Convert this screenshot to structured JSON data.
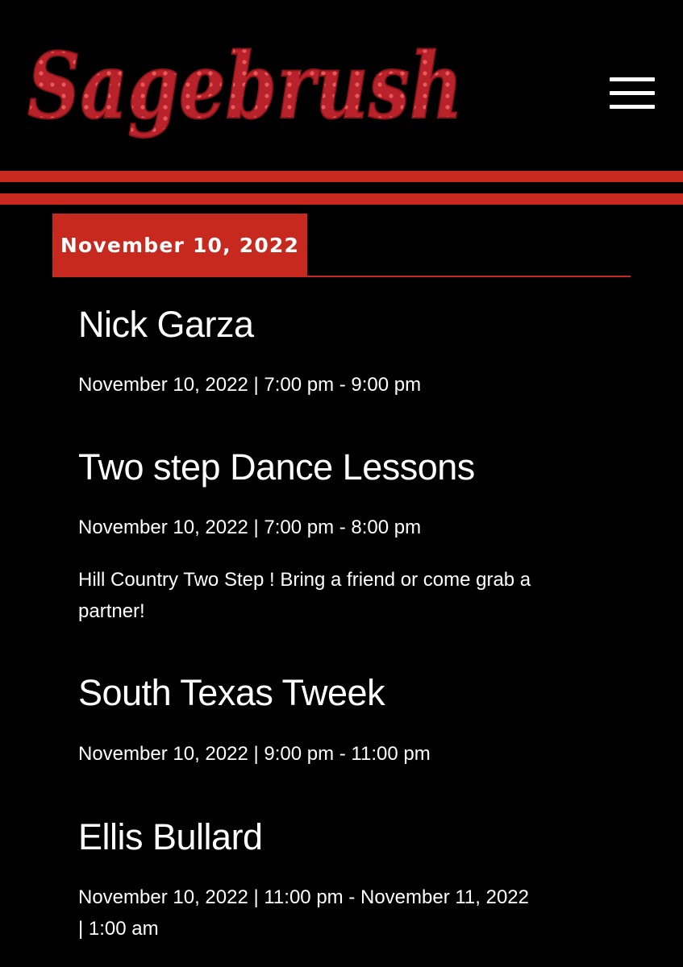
{
  "header": {
    "logo_text": "Sagebrush",
    "menu_icon": "hamburger-menu-icon"
  },
  "colors": {
    "accent": "#c8291f",
    "logo_fill": "#b8222a",
    "logo_dots": "#e85a5a",
    "background": "#000000",
    "text": "#ffffff"
  },
  "date_heading": "November 10, 2022",
  "events": [
    {
      "title": "Nick Garza",
      "meta": "November 10, 2022 | 7:00 pm - 9:00 pm",
      "description": ""
    },
    {
      "title": "Two step Dance Lessons",
      "meta": "November 10, 2022 | 7:00 pm - 8:00 pm",
      "description": "Hill Country Two Step ! Bring a friend or come grab a partner!"
    },
    {
      "title": "South Texas Tweek",
      "meta": "November 10, 2022 | 9:00 pm - 11:00 pm",
      "description": ""
    },
    {
      "title": "Ellis Bullard",
      "meta": "November 10, 2022 | 11:00 pm - November 11, 2022 | 1:00 am",
      "description": ""
    }
  ]
}
